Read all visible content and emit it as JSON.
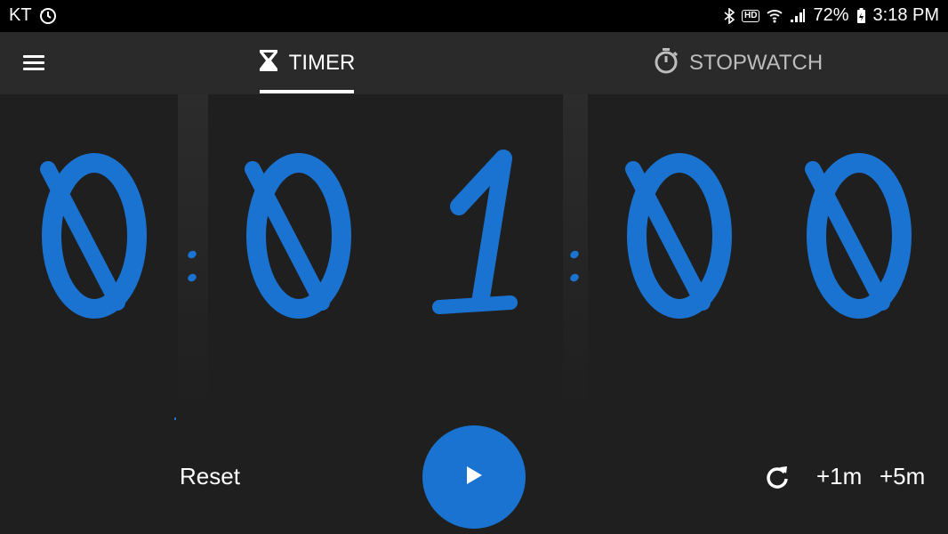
{
  "status_bar": {
    "carrier": "KT",
    "battery": "72%",
    "time": "3:18 PM",
    "hd_label": "HD"
  },
  "tabs": [
    {
      "label": "TIMER",
      "icon": "hourglass-icon",
      "active": true
    },
    {
      "label": "STOPWATCH",
      "icon": "stopwatch-icon",
      "active": false
    }
  ],
  "timer": {
    "digits": [
      "0",
      "0",
      "1",
      "0",
      "0"
    ],
    "color": "#1a73d1"
  },
  "controls": {
    "reset_label": "Reset",
    "add_1m_label": "+1m",
    "add_5m_label": "+5m"
  },
  "colors": {
    "accent": "#1a73d1",
    "background": "#1f1f1f",
    "appbar": "#2a2a2a"
  }
}
